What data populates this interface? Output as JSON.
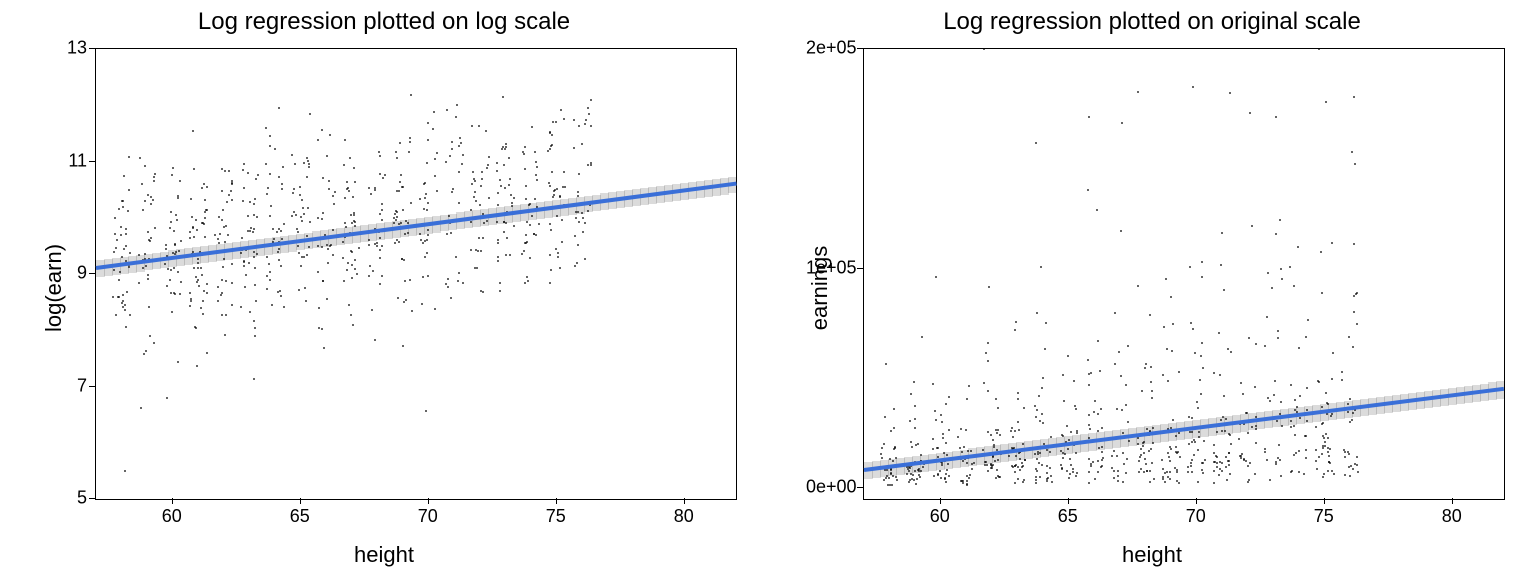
{
  "chart_data": [
    {
      "type": "scatter",
      "title": "Log regression plotted on log scale",
      "xlabel": "height",
      "ylabel": "log(earn)",
      "xlim": [
        57,
        82
      ],
      "ylim": [
        5,
        13
      ],
      "x_ticks": [
        60,
        65,
        70,
        75,
        80
      ],
      "y_ticks": [
        5,
        7,
        9,
        11,
        13
      ],
      "regression_line": {
        "x1": 57,
        "y1": 9.1,
        "x2": 82,
        "y2": 10.6
      },
      "ci_halfwidth": 0.15,
      "n_points": 700,
      "scatter_note": "dense jittered integer heights 58–78; log(earn) roughly 6–12, cluster 8–11"
    },
    {
      "type": "scatter",
      "title": "Log regression plotted on original scale",
      "xlabel": "height",
      "ylabel": "earnings",
      "xlim": [
        57,
        82
      ],
      "ylim": [
        -5000,
        200000
      ],
      "x_ticks": [
        60,
        65,
        70,
        75,
        80
      ],
      "y_ticks": [
        0,
        100000,
        200000
      ],
      "y_tick_labels": [
        "0e+00",
        "1e+05",
        "2e+05"
      ],
      "regression_line": {
        "x1": 57,
        "y1": 8000,
        "x2": 82,
        "y2": 45000
      },
      "ci_halfwidth": 4000,
      "n_points": 700,
      "scatter_note": "same heights; earnings exp-distributed, most 0–50k, few up to 200k"
    }
  ]
}
